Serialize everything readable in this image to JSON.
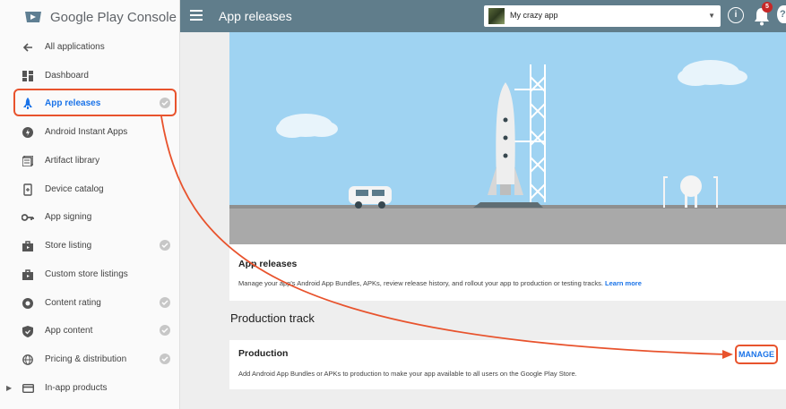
{
  "brand": {
    "title": "Google Play Console"
  },
  "sidebar": {
    "items": [
      {
        "label": "All applications",
        "icon": "back-arrow-icon",
        "checked": false
      },
      {
        "label": "Dashboard",
        "icon": "dashboard-icon",
        "checked": false
      },
      {
        "label": "App releases",
        "icon": "rocket-icon",
        "checked": true,
        "active": true
      },
      {
        "label": "Android Instant Apps",
        "icon": "instant-apps-icon",
        "checked": false
      },
      {
        "label": "Artifact library",
        "icon": "library-icon",
        "checked": false
      },
      {
        "label": "Device catalog",
        "icon": "device-icon",
        "checked": false
      },
      {
        "label": "App signing",
        "icon": "key-icon",
        "checked": false
      },
      {
        "label": "Store listing",
        "icon": "store-icon",
        "checked": true
      },
      {
        "label": "Custom store listings",
        "icon": "store-icon",
        "checked": false
      },
      {
        "label": "Content rating",
        "icon": "rating-icon",
        "checked": true
      },
      {
        "label": "App content",
        "icon": "shield-icon",
        "checked": true
      },
      {
        "label": "Pricing & distribution",
        "icon": "globe-icon",
        "checked": true
      },
      {
        "label": "In-app products",
        "icon": "credit-card-icon",
        "checked": false,
        "expandable": true
      }
    ]
  },
  "topbar": {
    "title": "App releases",
    "app_name": "My crazy app",
    "notification_count": "5",
    "help_label": "?"
  },
  "app_releases_card": {
    "title": "App releases",
    "description": "Manage your app's Android App Bundles, APKs, review release history, and rollout your app to production or testing tracks.",
    "link": "Learn more"
  },
  "production_track": {
    "section_title": "Production track",
    "card_title": "Production",
    "description": "Add Android App Bundles or APKs to production to make your app available to all users on the Google Play Store.",
    "manage_label": "MANAGE"
  },
  "colors": {
    "topbar": "#607d8b",
    "accent": "#1a73e8",
    "highlight": "#e8532d",
    "sky": "#9fd3f2"
  }
}
